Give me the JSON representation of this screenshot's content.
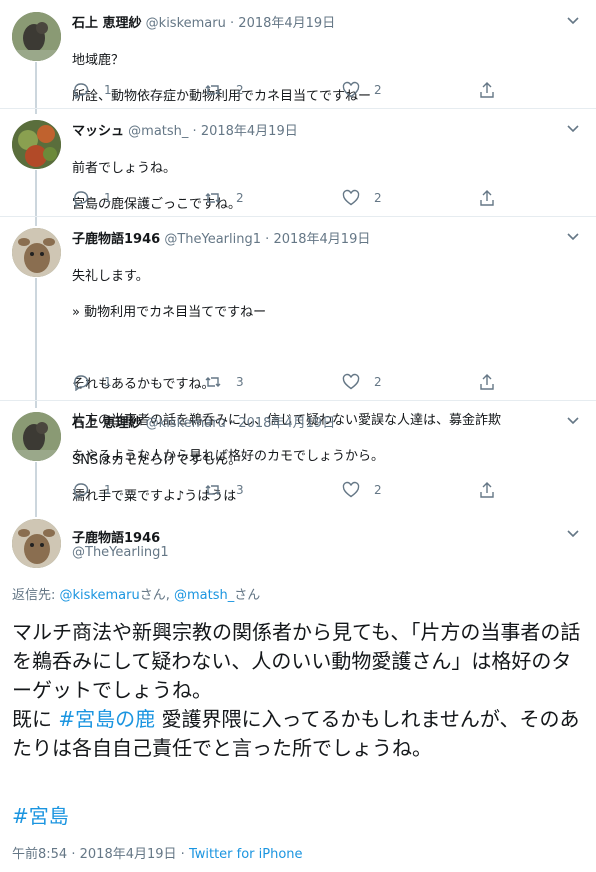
{
  "tweets": [
    {
      "name": "石上 恵理紗",
      "handle": "@kiskemaru",
      "dot": "·",
      "date": "2018年4月19日",
      "lines": [
        "地域鹿？",
        "所詮、動物依存症か動物利用でカネ目当てですねー"
      ],
      "replies": "1",
      "retweets": "2",
      "likes": "2"
    },
    {
      "name": "マッシュ",
      "handle": "@matsh_",
      "dot": "·",
      "date": "2018年4月19日",
      "lines": [
        "前者でしょうね。",
        "宮島の鹿保護ごっこですね。"
      ],
      "replies": "1",
      "retweets": "2",
      "likes": "2"
    },
    {
      "name": "子鹿物語1946",
      "handle": "@TheYearling1",
      "dot": "·",
      "date": "2018年4月19日",
      "lines": [
        "失礼します。",
        "» 動物利用でカネ目当てですねー",
        "",
        "それもあるかもですね。",
        "片方の当事者の話を鵜呑みにし、信じて疑わない愛誤な人達は、募金詐欺",
        "をやるような人から見れば格好のカモでしょうから。"
      ],
      "replies": "1",
      "retweets": "3",
      "likes": "2"
    },
    {
      "name": "石上 恵理紗",
      "handle": "@kiskemaru",
      "dot": "·",
      "date": "2018年4月19日",
      "lines": [
        "SNSはカモだらけですもん。",
        "濡れ手で粟ですよ♪うはうは"
      ],
      "replies": "1",
      "retweets": "3",
      "likes": "2"
    }
  ],
  "main": {
    "name": "子鹿物語1946",
    "handle": "@TheYearling1",
    "reply_prefix": "返信先: ",
    "reply_user1": "@kiskemaru",
    "reply_mid": "さん, ",
    "reply_user2": "@matsh_",
    "reply_suffix": "さん",
    "text_part1": "マルチ商法や新興宗教の関係者から見ても、「片方の当事者の話を鵜呑みにして疑わない、人のいい動物愛護さん」は格好のターゲットでしょうね。",
    "text_part2_prefix": "既に ",
    "hashtag_inline": "#宮島の鹿",
    "text_part2_suffix": " 愛護界隈に入ってるかもしれませんが、そのあたりは各自自己責任でと言った所でしょうね。",
    "hashtag_end": "#宮島",
    "time": "午前8:54",
    "date": "2018年4月19日",
    "via": "Twitter for iPhone",
    "dot": "·"
  },
  "colors": {
    "link": "#1b95e0",
    "muted": "#657786",
    "border": "#e6ecf0"
  }
}
